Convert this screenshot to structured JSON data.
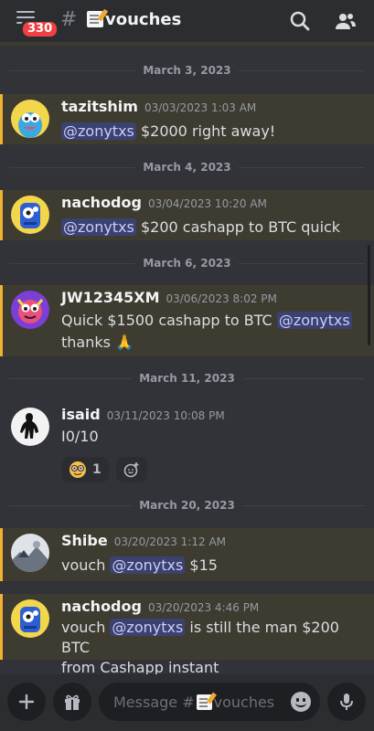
{
  "header": {
    "unread_badge": "330",
    "hash": "#",
    "channel_name": "vouches"
  },
  "messages": [
    {
      "date": "March 3, 2023",
      "username": "tazitshim",
      "timestamp": "03/03/2023 1:03 AM",
      "mention": "@zonytxs",
      "text_after": " $2000 right away!",
      "highlighted": true
    },
    {
      "date": "March 4, 2023",
      "username": "nachodog",
      "timestamp": "03/04/2023 10:20 AM",
      "mention": "@zonytxs",
      "text_after": " $200 cashapp to BTC quick",
      "highlighted": true
    },
    {
      "date": "March 6, 2023",
      "username": "JW12345XM",
      "timestamp": "03/06/2023 8:02 PM",
      "text_before": "Quick $1500 cashapp to BTC ",
      "mention": "@zonytxs",
      "text_line2": "thanks",
      "highlighted": true
    },
    {
      "date": "March 11, 2023",
      "username": "isaid",
      "timestamp": "03/11/2023 10:08 PM",
      "text": "I0/10",
      "reaction_count": "1",
      "highlighted": false
    },
    {
      "date": "March 20, 2023",
      "username": "Shibe",
      "timestamp": "03/20/2023 1:12 AM",
      "text_before": "vouch ",
      "mention": "@zonytxs",
      "text_after": " $15",
      "highlighted": true
    },
    {
      "username": "nachodog",
      "timestamp": "03/20/2023 4:46 PM",
      "text_before": "vouch ",
      "mention": "@zonytxs",
      "text_after": " is still the man $200 BTC",
      "text_line2": "from Cashapp instant",
      "highlighted": true
    }
  ],
  "composer": {
    "placeholder_prefix": "Message #",
    "placeholder_channel": "vouches"
  },
  "colors": {
    "background": "#313338",
    "header": "#2b2d31",
    "highlight": "#3e3b30",
    "highlight_border": "#f0b232",
    "mention_bg": "#3c4270",
    "badge": "#f23f43"
  }
}
